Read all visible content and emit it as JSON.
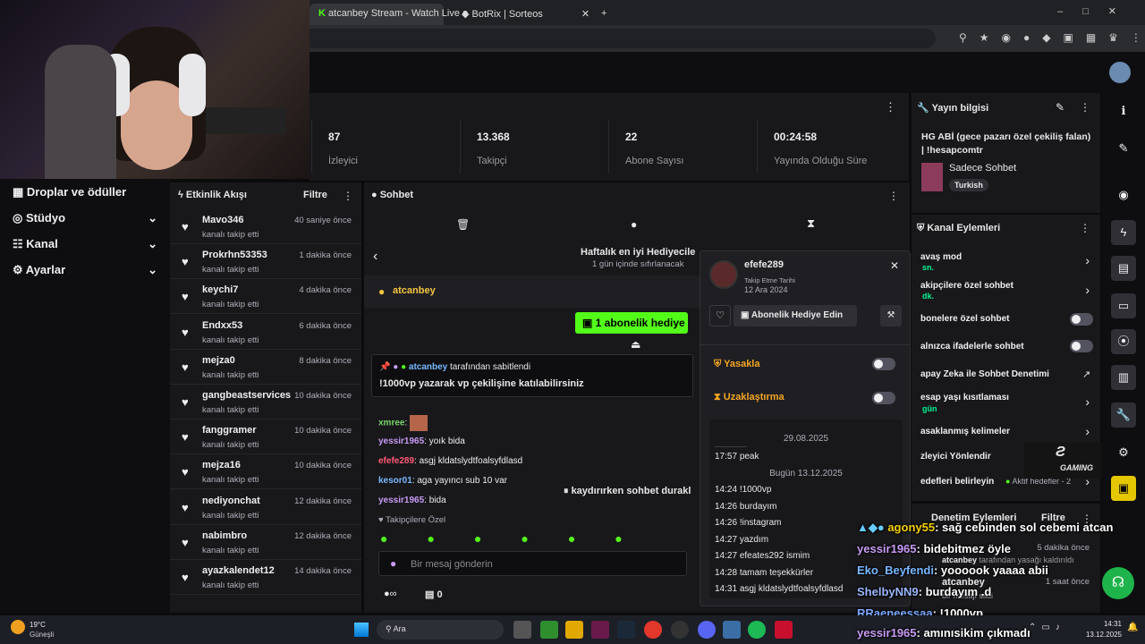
{
  "browser": {
    "tabs": [
      {
        "label": "atcanbey Stream - Watch Live o"
      },
      {
        "label": "BotRix | Sorteos"
      }
    ],
    "new_tab": "+"
  },
  "left_nav": {
    "items": [
      {
        "label": "Droplar ve ödüller"
      },
      {
        "label": "Stüdyo"
      },
      {
        "label": "Kanal"
      },
      {
        "label": "Ayarlar"
      }
    ]
  },
  "stats": [
    {
      "value": "87",
      "label": "İzleyici"
    },
    {
      "value": "13.368",
      "label": "Takipçi"
    },
    {
      "value": "22",
      "label": "Abone Sayısı"
    },
    {
      "value": "00:24:58",
      "label": "Yayında Olduğu Süre"
    }
  ],
  "activity": {
    "title": "Etkinlik Akışı",
    "filter": "Filtre",
    "items": [
      {
        "name": "Mavo346",
        "sub": "kanalı takip etti",
        "time": "40 saniye önce"
      },
      {
        "name": "Prokrhn53353",
        "sub": "kanalı takip etti",
        "time": "1 dakika önce"
      },
      {
        "name": "keychi7",
        "sub": "kanalı takip etti",
        "time": "4 dakika önce"
      },
      {
        "name": "Endxx53",
        "sub": "kanalı takip etti",
        "time": "6 dakika önce"
      },
      {
        "name": "mejza0",
        "sub": "kanalı takip etti",
        "time": "8 dakika önce"
      },
      {
        "name": "gangbeastservices",
        "sub": "kanalı takip etti",
        "time": "10 dakika önce"
      },
      {
        "name": "fanggramer",
        "sub": "kanalı takip etti",
        "time": "10 dakika önce"
      },
      {
        "name": "mejza16",
        "sub": "kanalı takip etti",
        "time": "10 dakika önce"
      },
      {
        "name": "nediyonchat",
        "sub": "kanalı takip etti",
        "time": "12 dakika önce"
      },
      {
        "name": "nabimbro",
        "sub": "kanalı takip etti",
        "time": "12 dakika önce"
      },
      {
        "name": "ayazkalendet12",
        "sub": "kanalı takip etti",
        "time": "14 dakika önce"
      }
    ]
  },
  "chat": {
    "title": "Sohbet",
    "gift_title": "Haftalık en iyi Hediyecile",
    "gift_sub": "1 gün içinde sıfırlanacak",
    "host": "atcanbey",
    "gift_button": "1 abonelik hediye e",
    "pinned_by": "atcanbey",
    "pinned_by_suffix": "tarafından sabitlendi",
    "pinned_text": "!1000vp yazarak vp çekilişine katılabilirsiniz",
    "messages": [
      {
        "user": "xmree",
        "text": "",
        "color": "#7bd46b"
      },
      {
        "user": "yessir1965",
        "text": "yoık bida",
        "color": "#c89bf5"
      },
      {
        "user": "efefe289",
        "text": "asgj kldatslydtfoalsyfdlasd",
        "color": "#ff5a75"
      },
      {
        "user": "kesor01",
        "text": "aga yayıncı sub 10 var",
        "color": "#79b8ff"
      },
      {
        "user": "yessir1965",
        "text": "bida",
        "color": "#c89bf5"
      }
    ],
    "paused": "kaydırırken sohbet durakl",
    "followers_only": "Takipçilere Özel",
    "input_placeholder": "Bir mesaj gönderin",
    "count": "0"
  },
  "popup": {
    "username": "efefe289",
    "follow_label": "Takip Etme Tarihi",
    "follow_date": "12 Ara 2024",
    "gift_sub_button": "Abonelik Hediye Edin",
    "ban": "Yasakla",
    "timeout": "Uzaklaştırma",
    "date1": "29.08.2025",
    "history1": [
      {
        "time": "17:57",
        "text": "peak"
      }
    ],
    "date2": "Bugün 13.12.2025",
    "history2": [
      {
        "time": "14:24",
        "text": "!1000vp"
      },
      {
        "time": "14:26",
        "text": "burdayım"
      },
      {
        "time": "14:26",
        "text": "!instagram"
      },
      {
        "time": "14:27",
        "text": "yazdım"
      },
      {
        "time": "14:27",
        "text": "efeates292 ismim"
      },
      {
        "time": "14:28",
        "text": "tamam teşekkürler"
      },
      {
        "time": "14:31",
        "text": "asgj kldatslydtfoalsyfdlasd"
      }
    ]
  },
  "stream_info": {
    "title": "Yayın bilgisi",
    "stream_title": "HG ABİ (gece pazarı özel çekiliş falan) | !hesapcomtr",
    "category": "Sadece Sohbet",
    "tag": "Turkish"
  },
  "channel_actions": {
    "title": "Kanal Eylemleri",
    "items": [
      {
        "label": "avaş mod",
        "sub": "sn."
      },
      {
        "label": "akipçilere özel sohbet",
        "sub": "dk."
      },
      {
        "label": "bonelere özel sohbet",
        "sub": ""
      },
      {
        "label": "alnızca ifadelerle sohbet",
        "sub": ""
      },
      {
        "label": "apay Zeka ile Sohbet Denetimi",
        "sub": ""
      },
      {
        "label": "esap yaşı kısıtlaması",
        "sub": "gün"
      },
      {
        "label": "asaklanmış kelimeler",
        "sub": ""
      },
      {
        "label": "zleyici Yönlendir",
        "sub": ""
      },
      {
        "label": "edefleri belirleyin",
        "sub": ""
      }
    ],
    "goals_badge": "Aktif hedefler - 2"
  },
  "moderation": {
    "title": "Denetim Eylemleri",
    "filter": "Filtre",
    "entries": [
      {
        "user": "atcanbey",
        "text": "tarafından yasağı kaldırıldı",
        "time": "5 dakika önce"
      },
      {
        "user": "atcanbey",
        "text": "bir mesajı sildi",
        "time": "1 saat önce"
      }
    ]
  },
  "overlay_chat": [
    {
      "user": "agony55",
      "text": ": sağ cebinden sol cebemi atcan",
      "color": "#f5d000"
    },
    {
      "user": "yessir1965",
      "text": ": bidebitmez öyle",
      "color": "#c89bf5"
    },
    {
      "user": "Eko_Beyfendi",
      "text": ": yoooook yaaaa abii",
      "color": "#79b8ff"
    },
    {
      "user": "ShelbyNN9",
      "text": ": burdayım .d",
      "color": "#9bb7ff"
    },
    {
      "user": "RRaeneessaa",
      "text": ": !1000vp",
      "color": "#7aa7ff"
    },
    {
      "user": "yessir1965",
      "text": ": amınısikim çıkmadı",
      "color": "#c89bf5"
    }
  ],
  "overlay_logo": "GAMING",
  "taskbar": {
    "weather_temp": "19°C",
    "weather_text": "Güneşli",
    "search": "Ara",
    "time": "14:31",
    "date": "13.12.2025"
  },
  "colors": {
    "accent": "#53fc18",
    "panel": "#18181b",
    "background": "#0e0e10"
  }
}
